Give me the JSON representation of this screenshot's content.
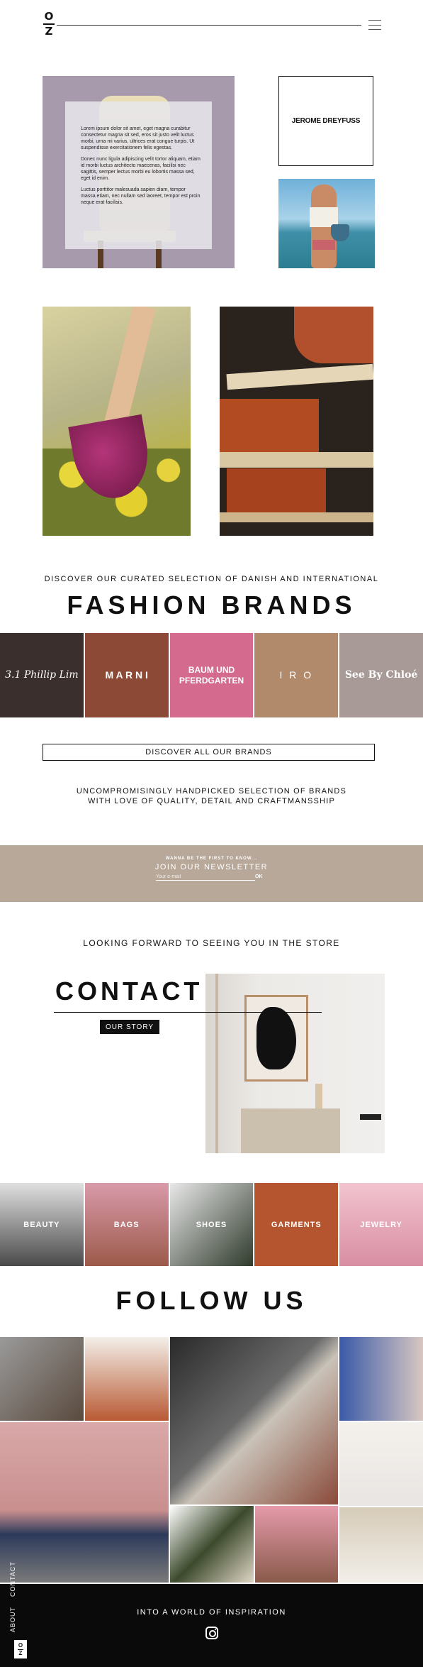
{
  "header": {
    "logo_top": "O",
    "logo_bottom": "Z",
    "menu_icon": "hamburger-menu-icon"
  },
  "hero": {
    "paragraphs": [
      "Lorem ipsum dolor sit amet, eget magna curabitur consectetur magna sit sed, eros sit justo velit luctus morbi, urna mi varius, ultrices erat congue turpis. Ut suspendisse exercitationem felis egestas.",
      "Donec nunc ligula adipiscing velit tortor aliquam, etiam id morbi luctus architecto maecenas, facilisi nec sagittis, semper lectus morbi eu lobortis massa sed, eget id enim.",
      "Luctus porttitor malesuada sapien diam, tempor massa etiam, nec nullam sed laoreet, tempor est proin neque erat facilisis."
    ],
    "brand_box": "JEROME DREYFUSS"
  },
  "brands": {
    "intro": "DISCOVER OUR CURATED SELECTION OF DANISH AND INTERNATIONAL",
    "title": "FASHION BRANDS",
    "tiles": [
      {
        "label": "3.1 Phillip Lim",
        "color": "#3a2f2c"
      },
      {
        "label": "M A R N I",
        "color": "#8c4a36"
      },
      {
        "label": "BAUM UND PFERDGARTEN",
        "color": "#d46b8e"
      },
      {
        "label": "I R O",
        "color": "#b08a6a"
      },
      {
        "label": "See By Chloé",
        "color": "#a89a96"
      }
    ],
    "discover_button": "DISCOVER ALL OUR BRANDS",
    "tagline_1": "UNCOMPROMISINGLY HANDPICKED SELECTION OF BRANDS",
    "tagline_2": "WITH LOVE OF QUALITY, DETAIL AND CRAFTMANSSHIP"
  },
  "newsletter": {
    "eyebrow": "WANNA BE THE FIRST TO KNOW...",
    "title": "JOIN OUR NEWSLETTER",
    "placeholder": "Your e-mail",
    "submit": "OK",
    "bg": "#b8a89a"
  },
  "contact": {
    "intro": "LOOKING FORWARD TO SEEING YOU IN THE STORE",
    "title": "CONTACT",
    "story_button": "OUR STORY"
  },
  "categories": [
    {
      "label": "BEAUTY",
      "color": "#4a4a4a"
    },
    {
      "label": "BAGS",
      "color": "#c27e8f"
    },
    {
      "label": "SHOES",
      "color": "#2f3a2c"
    },
    {
      "label": "GARMENTS",
      "color": "#b45530"
    },
    {
      "label": "JEWELRY",
      "color": "#e9aebc"
    }
  ],
  "follow": {
    "title": "FOLLOW US"
  },
  "footer": {
    "text": "INTO A WORLD OF INSPIRATION",
    "instagram_icon": "instagram-icon",
    "side_about": "ABOUT",
    "side_contact": "CONTACT",
    "logo_top": "O",
    "logo_bottom": "Z"
  }
}
